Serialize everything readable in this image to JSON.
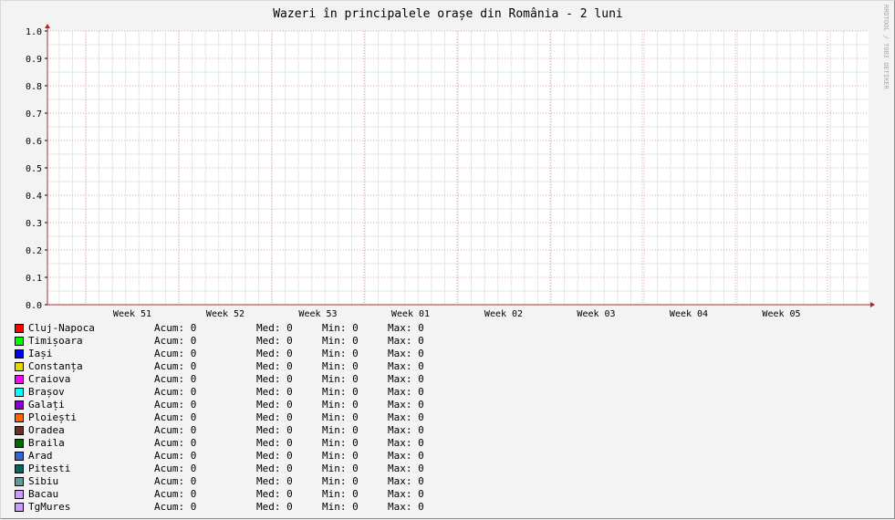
{
  "chart_data": {
    "type": "line",
    "title": "Wazeri în principalele orașe din România - 2 luni",
    "watermark": "RRDTOOL / TOBI OETIKER",
    "ylim": [
      0,
      1.0
    ],
    "y_ticks": [
      "0.0",
      "0.1",
      "0.2",
      "0.3",
      "0.4",
      "0.5",
      "0.6",
      "0.7",
      "0.8",
      "0.9",
      "1.0"
    ],
    "x_ticks": [
      "Week 51",
      "Week 52",
      "Week 53",
      "Week 01",
      "Week 02",
      "Week 03",
      "Week 04",
      "Week 05"
    ],
    "grid": true,
    "legend_labels": {
      "current": "Acum:",
      "average": "Med:",
      "min": "Min:",
      "max": "Max:"
    },
    "series": [
      {
        "name": "Cluj-Napoca",
        "color": "#ff0000",
        "current": "0",
        "average": "0",
        "min": "0",
        "max": "0",
        "values": [
          0,
          0
        ]
      },
      {
        "name": "Timișoara",
        "color": "#00ff00",
        "current": "0",
        "average": "0",
        "min": "0",
        "max": "0",
        "values": [
          0,
          0
        ]
      },
      {
        "name": "Iași",
        "color": "#0000ff",
        "current": "0",
        "average": "0",
        "min": "0",
        "max": "0",
        "values": [
          0,
          0
        ]
      },
      {
        "name": "Constanța",
        "color": "#e8d800",
        "current": "0",
        "average": "0",
        "min": "0",
        "max": "0",
        "values": [
          0,
          0
        ]
      },
      {
        "name": "Craiova",
        "color": "#ff00ff",
        "current": "0",
        "average": "0",
        "min": "0",
        "max": "0",
        "values": [
          0,
          0
        ]
      },
      {
        "name": "Brașov",
        "color": "#00ffff",
        "current": "0",
        "average": "0",
        "min": "0",
        "max": "0",
        "values": [
          0,
          0
        ]
      },
      {
        "name": "Galați",
        "color": "#8800cc",
        "current": "0",
        "average": "0",
        "min": "0",
        "max": "0",
        "values": [
          0,
          0
        ]
      },
      {
        "name": "Ploiești",
        "color": "#ff6600",
        "current": "0",
        "average": "0",
        "min": "0",
        "max": "0",
        "values": [
          0,
          0
        ]
      },
      {
        "name": "Oradea",
        "color": "#663322",
        "current": "0",
        "average": "0",
        "min": "0",
        "max": "0",
        "values": [
          0,
          0
        ]
      },
      {
        "name": "Braila",
        "color": "#006600",
        "current": "0",
        "average": "0",
        "min": "0",
        "max": "0",
        "values": [
          0,
          0
        ]
      },
      {
        "name": "Arad",
        "color": "#3366cc",
        "current": "0",
        "average": "0",
        "min": "0",
        "max": "0",
        "values": [
          0,
          0
        ]
      },
      {
        "name": "Pitesti",
        "color": "#006666",
        "current": "0",
        "average": "0",
        "min": "0",
        "max": "0",
        "values": [
          0,
          0
        ]
      },
      {
        "name": "Sibiu",
        "color": "#669999",
        "current": "0",
        "average": "0",
        "min": "0",
        "max": "0",
        "values": [
          0,
          0
        ]
      },
      {
        "name": "Bacau",
        "color": "#cc99ff",
        "current": "0",
        "average": "0",
        "min": "0",
        "max": "0",
        "values": [
          0,
          0
        ]
      },
      {
        "name": "TgMures",
        "color": "#cc99ff",
        "current": "0",
        "average": "0",
        "min": "0",
        "max": "0",
        "values": [
          0,
          0
        ]
      }
    ]
  }
}
